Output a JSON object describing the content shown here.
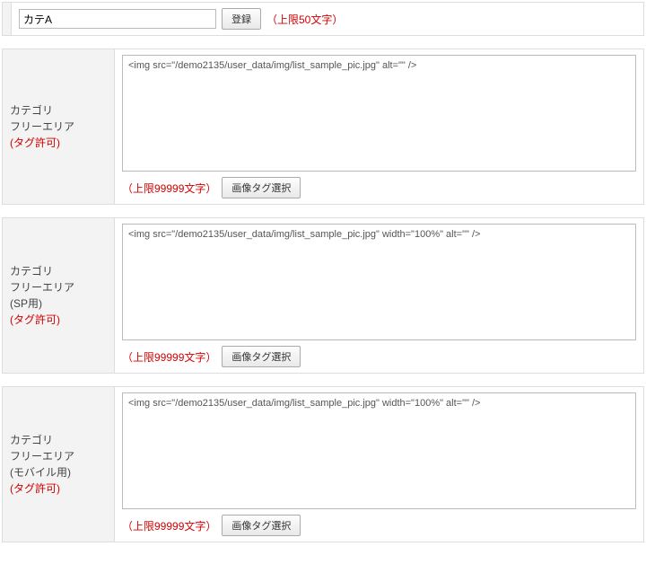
{
  "top_row": {
    "field_value": "カテA",
    "register_btn": "登録",
    "limit_note": "（上限50文字）"
  },
  "sections": [
    {
      "label_line1": "カテゴリ",
      "label_line2": "フリーエリア",
      "label_line3": null,
      "note": "(タグ許可)",
      "textarea_value": "<img src=\"/demo2135/user_data/img/list_sample_pic.jpg\" alt=\"\" />",
      "limit_note": "（上限99999文字）",
      "select_btn": "画像タグ選択"
    },
    {
      "label_line1": "カテゴリ",
      "label_line2": "フリーエリア",
      "label_line3": "(SP用)",
      "note": "(タグ許可)",
      "textarea_value": "<img src=\"/demo2135/user_data/img/list_sample_pic.jpg\" width=\"100%\" alt=\"\" />",
      "limit_note": "（上限99999文字）",
      "select_btn": "画像タグ選択"
    },
    {
      "label_line1": "カテゴリ",
      "label_line2": "フリーエリア",
      "label_line3": "(モバイル用)",
      "note": "(タグ許可)",
      "textarea_value": "<img src=\"/demo2135/user_data/img/list_sample_pic.jpg\" width=\"100%\" alt=\"\" />",
      "limit_note": "（上限99999文字）",
      "select_btn": "画像タグ選択"
    }
  ]
}
